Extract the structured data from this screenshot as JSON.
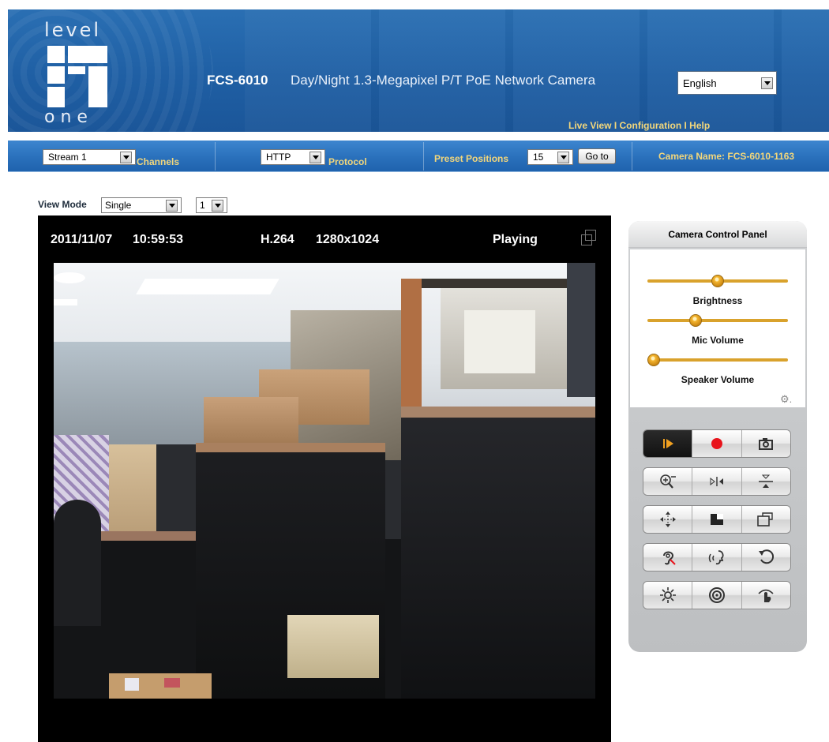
{
  "header": {
    "logo_top": "level",
    "logo_bottom": "one",
    "model": "FCS-6010",
    "description": "Day/Night 1.3-Megapixel P/T PoE Network Camera",
    "language": "English",
    "links": {
      "live_view": "Live View",
      "configuration": "Configuration",
      "help": "Help",
      "separator": " I "
    }
  },
  "toolbar": {
    "stream": "Stream 1",
    "channels_label": "Channels",
    "protocol": "HTTP",
    "protocol_label": "Protocol",
    "preset_label": "Preset Positions",
    "preset_value": "15",
    "goto_label": "Go to",
    "camera_name": "Camera Name: FCS-6010-1163"
  },
  "view_mode": {
    "label": "View Mode",
    "mode": "Single",
    "channel": "1"
  },
  "video": {
    "date": "2011/11/07",
    "time": "10:59:53",
    "codec": "H.264",
    "resolution": "1280x1024",
    "status": "Playing"
  },
  "control_panel": {
    "title": "Camera Control Panel",
    "brightness_label": "Brightness",
    "brightness_level": 0.5,
    "mic_label": "Mic Volume",
    "mic_level": 0.33,
    "speaker_label": "Speaker Volume",
    "speaker_level": 0.0
  },
  "colors": {
    "header_blue": "#1f5fa4",
    "toolbar_blue": "#2b72bd",
    "link_gold": "#f3d77b",
    "slider_gold": "#d9a22c",
    "record_red": "#e8141c",
    "play_orange": "#f0a020"
  }
}
